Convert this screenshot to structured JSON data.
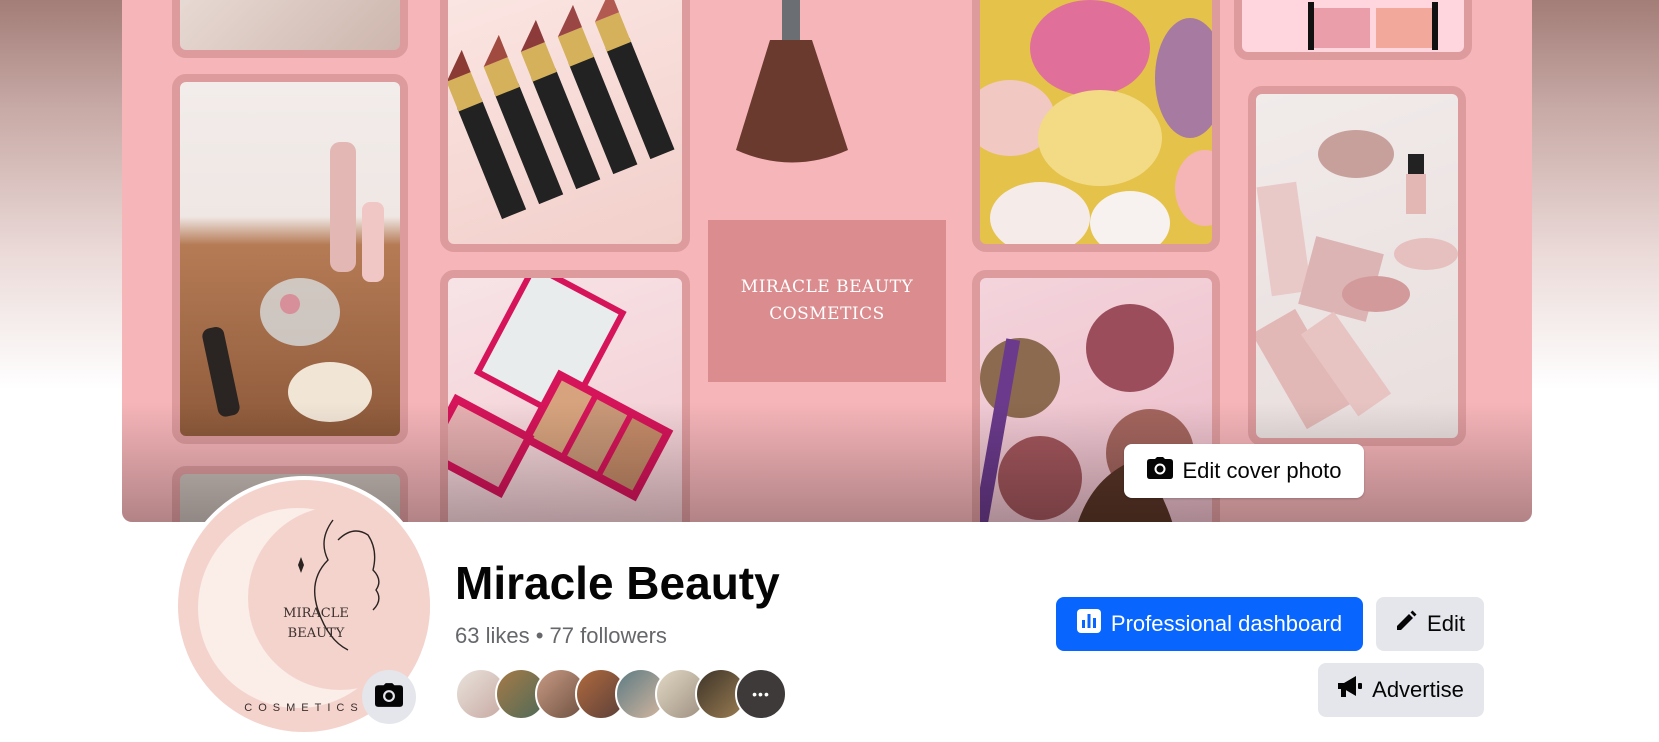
{
  "cover": {
    "brand_line1": "MIRACLE BEAUTY",
    "brand_line2": "COSMETICS",
    "edit_label": "Edit cover photo",
    "edit_icon": "camera-icon"
  },
  "avatar": {
    "logo_line1": "MIRACLE",
    "logo_line2": "BEAUTY",
    "logo_line3": "COSMETICS",
    "camera_icon": "camera-icon"
  },
  "page": {
    "name": "Miracle Beauty",
    "likes": "63 likes",
    "separator": " • ",
    "followers": "77 followers"
  },
  "friends": {
    "avatars": [
      "friend-1",
      "friend-2",
      "friend-3",
      "friend-4",
      "friend-5",
      "friend-6",
      "friend-7",
      "friend-8"
    ],
    "more_icon": "more-dots-icon"
  },
  "actions": {
    "professional_dashboard": "Professional dashboard",
    "professional_dashboard_icon": "bar-chart-icon",
    "edit": "Edit",
    "edit_icon": "pencil-icon",
    "advertise": "Advertise",
    "advertise_icon": "megaphone-icon"
  },
  "colors": {
    "accent": "#0866ff",
    "secondary_button": "#e4e6eb",
    "cover_pink": "#f6b5b9",
    "tile_border": "#de9b9e"
  }
}
